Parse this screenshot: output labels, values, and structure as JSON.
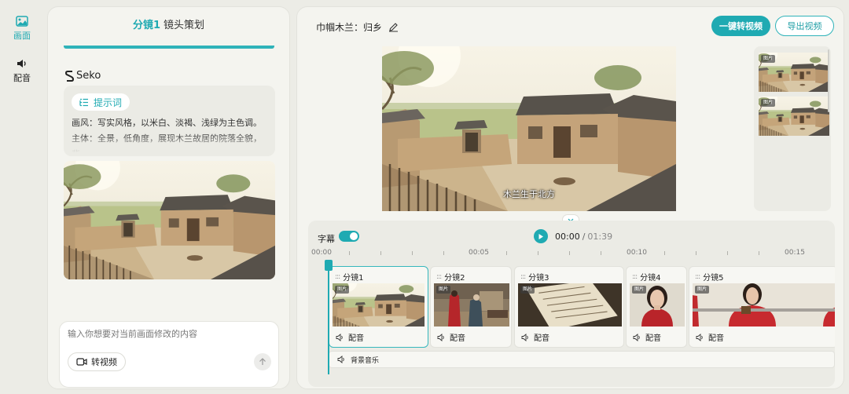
{
  "nav": {
    "items": [
      {
        "label": "画面",
        "icon": "image-icon",
        "active": true
      },
      {
        "label": "配音",
        "icon": "speaker-icon",
        "active": false
      }
    ]
  },
  "left_panel": {
    "header": {
      "shot": "分镜1",
      "plan": "镜头策划"
    },
    "brand": "Seko",
    "prompt": {
      "chip_label": "提示词",
      "text": "画风：写实风格，以米白、淡褐、浅绿为主色调。主体：全景，低角度，展现木兰故居的院落全貌，背"
    },
    "input": {
      "placeholder": "输入你想要对当前画面修改的内容",
      "to_video_label": "转视频"
    }
  },
  "main": {
    "title": "巾帼木兰：归乡",
    "buttons": {
      "convert": "一键转视频",
      "export": "导出视频"
    },
    "subtitle": "木兰生于北方",
    "thumb_tags": [
      "图片",
      "图片"
    ],
    "timeline": {
      "subtitle_label": "字幕",
      "subtitle_enabled": true,
      "current_time": "00:00",
      "separator": "/",
      "total_time": "01:39",
      "ruler_labels": [
        "00:00",
        "00:05",
        "00:10",
        "00:15"
      ],
      "clips": [
        {
          "label": "分镜1",
          "tag": "图片",
          "audio": "配音",
          "active": true
        },
        {
          "label": "分镜2",
          "tag": "图片",
          "audio": "配音",
          "active": false
        },
        {
          "label": "分镜3",
          "tag": "图片",
          "audio": "配音",
          "active": false
        },
        {
          "label": "分镜4",
          "tag": "图片",
          "audio": "配音",
          "active": false
        },
        {
          "label": "分镜5",
          "tag": "图片",
          "audio": "配音",
          "active": false
        }
      ],
      "bgm_label": "背景音乐"
    }
  },
  "colors": {
    "accent": "#1faab2",
    "panel": "#f4f4ef",
    "background": "#ecece6"
  }
}
